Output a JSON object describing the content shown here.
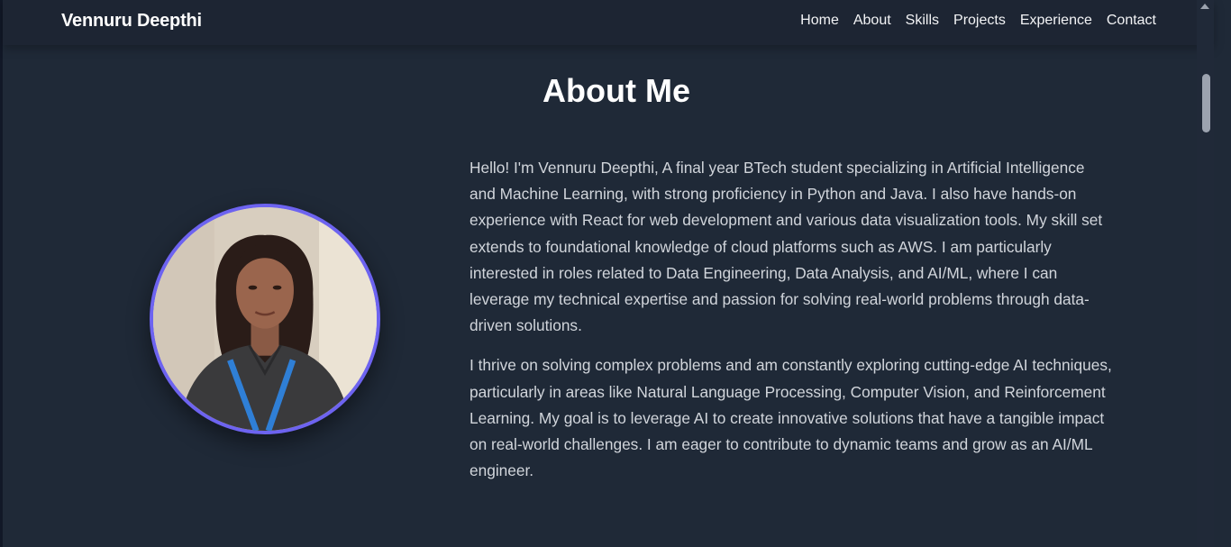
{
  "brand": {
    "name": "Vennuru Deepthi"
  },
  "nav": {
    "links": [
      "Home",
      "About",
      "Skills",
      "Projects",
      "Experience",
      "Contact"
    ]
  },
  "about": {
    "title": "About Me",
    "paragraphs": [
      "Hello! I'm Vennuru Deepthi, A final year BTech student specializing in Artificial Intelligence and Machine Learning, with strong proficiency in Python and Java. I also have hands-on experience with React for web development and various data visualization tools. My skill set extends to foundational knowledge of cloud platforms such as AWS. I am particularly interested in roles related to Data Engineering, Data Analysis, and AI/ML, where I can leverage my technical expertise and passion for solving real-world problems through data-driven solutions.",
      "I thrive on solving complex problems and am constantly exploring cutting-edge AI techniques, particularly in areas like Natural Language Processing, Computer Vision, and Reinforcement Learning. My goal is to leverage AI to create innovative solutions that have a tangible impact on real-world challenges. I am eager to contribute to dynamic teams and grow as an AI/ML engineer."
    ]
  },
  "colors": {
    "background": "#1f2937",
    "navbar": "#1d2533",
    "accent": "#6d63f0",
    "text": "#d1d5db"
  }
}
